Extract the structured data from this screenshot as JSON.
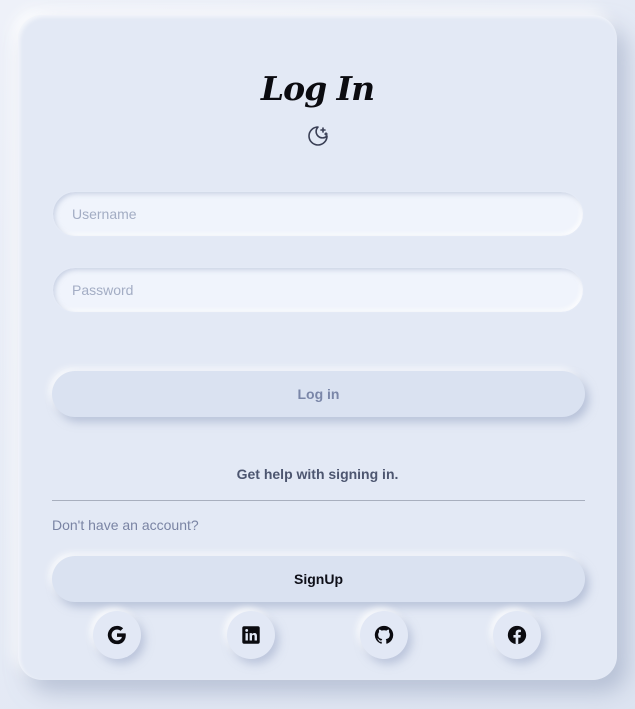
{
  "login": {
    "title": "Log In",
    "theme_icon": "moon-stars-icon",
    "username": {
      "placeholder": "Username",
      "value": ""
    },
    "password": {
      "placeholder": "Password",
      "value": ""
    },
    "login_button": "Log in",
    "help_link": "Get help with signing in.",
    "no_account_text": "Don't have an account?",
    "signup_button": "SignUp",
    "social": [
      {
        "name": "google",
        "icon": "google-icon"
      },
      {
        "name": "linkedin",
        "icon": "linkedin-icon"
      },
      {
        "name": "github",
        "icon": "github-icon"
      },
      {
        "name": "facebook",
        "icon": "facebook-icon"
      }
    ]
  },
  "colors": {
    "background": "#e3e8f4",
    "card": "#e3e9f5",
    "input_bg": "#f0f4fc",
    "button_bg": "#dae2f1",
    "title_text": "#0b0b10",
    "muted_text": "#7a84a4"
  }
}
